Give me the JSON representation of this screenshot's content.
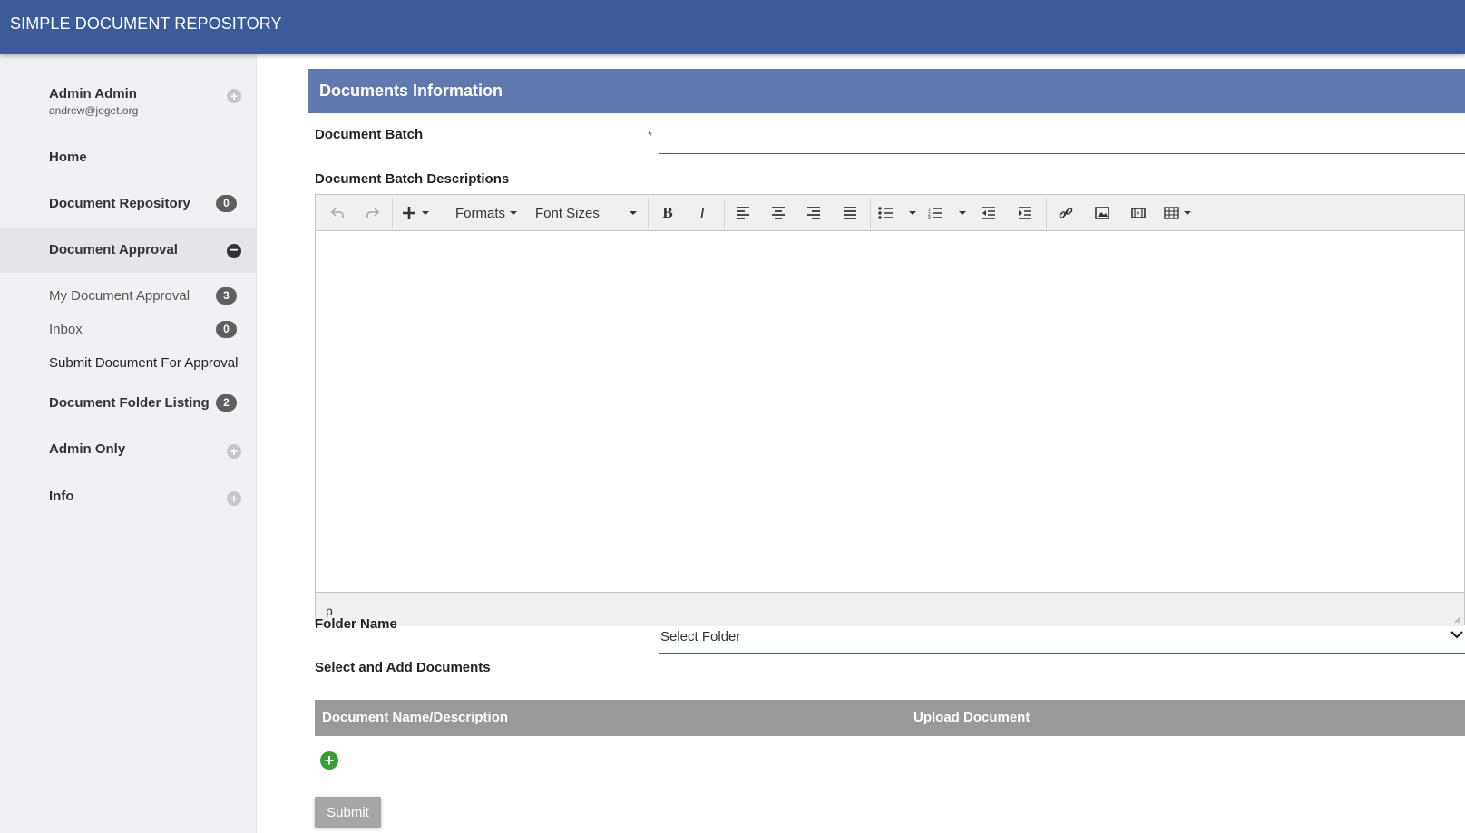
{
  "app": {
    "title": "SIMPLE DOCUMENT REPOSITORY"
  },
  "user": {
    "name": "Admin Admin",
    "email": "andrew@joget.org"
  },
  "nav": {
    "home": "Home",
    "repository": {
      "label": "Document Repository",
      "count": "0"
    },
    "approval": {
      "label": "Document Approval"
    },
    "my_approval": {
      "label": "My Document Approval",
      "count": "3"
    },
    "inbox": {
      "label": "Inbox",
      "count": "0"
    },
    "submit_for_approval": {
      "label": "Submit Document For Approval"
    },
    "folder_listing": {
      "label": "Document Folder Listing",
      "count": "2"
    },
    "admin_only": {
      "label": "Admin Only"
    },
    "info": {
      "label": "Info"
    }
  },
  "form": {
    "section_title": "Documents Information",
    "batch_label": "Document Batch",
    "required_mark": "*",
    "batch_value": "",
    "desc_label": "Document Batch Descriptions",
    "editor": {
      "formats": "Formats",
      "font_sizes": "Font Sizes",
      "status_path": "p"
    },
    "folder_label": "Folder Name",
    "folder_value": "Select Folder",
    "docs_label": "Select and Add Documents",
    "columns": [
      "Document Name/Description",
      "Upload Document"
    ],
    "submit": "Submit"
  },
  "colors": {
    "topbar": "#3d5a99",
    "section_header": "#6279b0",
    "grid_header": "#999999",
    "add_button": "#3a9d3a",
    "badge": "#5f5f5f"
  }
}
